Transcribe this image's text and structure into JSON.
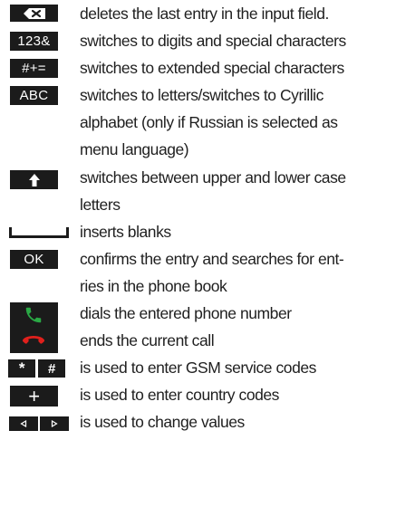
{
  "keys": [
    {
      "id": "backspace",
      "icon": "backspace-icon",
      "lines": [
        "deletes the last entry in the input field."
      ]
    },
    {
      "id": "digits",
      "key_label": "123&",
      "lines": [
        "switches to digits and special characters"
      ]
    },
    {
      "id": "extended",
      "key_label": "#+=",
      "lines": [
        "switches to extended special characters"
      ]
    },
    {
      "id": "letters",
      "key_label": "ABC",
      "lines": [
        "switches to letters/switches to Cyrillic",
        "alphabet (only if Russian is selected as",
        "menu language)"
      ]
    },
    {
      "id": "shift",
      "icon": "shift-arrow-icon",
      "lines": [
        "switches between upper and lower case",
        "letters"
      ]
    },
    {
      "id": "space",
      "icon": "space-bar-icon",
      "lines": [
        "inserts blanks"
      ]
    },
    {
      "id": "ok",
      "key_label": "OK",
      "lines": [
        "confirms the entry and searches for ent-",
        "ries in the phone book"
      ]
    },
    {
      "id": "call",
      "icon": "green-phone-icon",
      "lines": [
        "dials the entered phone number"
      ]
    },
    {
      "id": "end-call",
      "icon": "red-phone-icon",
      "lines": [
        "ends the current call"
      ]
    },
    {
      "id": "star-hash",
      "key_labels": [
        "*",
        "#"
      ],
      "lines": [
        "is used to enter GSM service codes"
      ]
    },
    {
      "id": "plus",
      "key_label": "+",
      "lines": [
        "is used to enter country codes"
      ]
    },
    {
      "id": "arrows",
      "icons": [
        "arrow-left-icon",
        "arrow-right-icon"
      ],
      "lines": [
        "is used to change values"
      ]
    }
  ],
  "colors": {
    "key_bg": "#1b1b1b",
    "text": "#1f1f1f",
    "call_green": "#2aa845",
    "end_red": "#e0201c"
  }
}
